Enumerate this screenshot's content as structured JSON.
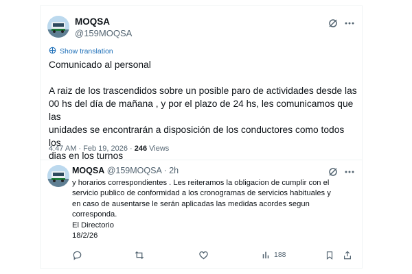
{
  "tweet": {
    "author_name": "MOQSA",
    "author_handle": "@159MOQSA",
    "show_translation_label": "Show translation",
    "title_line": "Comunicado al personal",
    "body": "A raiz de los trascendidos sobre un posible paro de actividades desde las\n00 hs del día de mañana ,  y por el plazo de 24 hs, les comunicamos que las\nunidades se encontrarán a disposición de los conductores  como todos los\ndias en los turnos",
    "time_date": "4:47 AM · Feb 19, 2026 · ",
    "views_count": "246",
    "views_label": " Views"
  },
  "reply": {
    "author_name": "MOQSA",
    "author_handle": " @159MOQSA · 2h",
    "body": "y horarios correspondientes . Les reiteramos la obligacion de cumplir con el\nservicio publico de conformidad a los cronogramas de servicios habituales y\nen caso de ausentarse le serán aplicadas las medidas acordes segun\ncorresponda.\nEl Directorio\n18/2/26",
    "views_count": "188"
  },
  "icons": {
    "grok": "grok-icon",
    "more": "more-icon",
    "translate": "globe-icon",
    "reply": "reply-icon",
    "retweet": "retweet-icon",
    "like": "like-icon",
    "views": "views-icon",
    "bookmark": "bookmark-icon",
    "share": "share-icon"
  },
  "colors": {
    "link": "#1d6fb8",
    "secondary_text": "#536471",
    "primary_text": "#0f1419"
  }
}
